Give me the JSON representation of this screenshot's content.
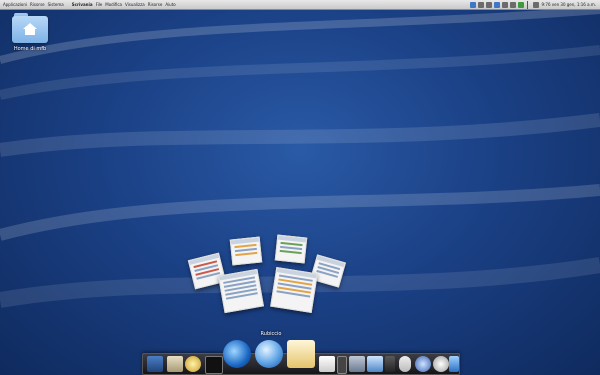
{
  "top_panel": {
    "menus": [
      "Applicazioni",
      "Risorse",
      "Sistema",
      "Scrivania",
      "File",
      "Modifica",
      "Visualizza",
      "Risorse",
      "Aiuto"
    ],
    "active_menu_index": 3,
    "clock": "9:76  ven 30 gen,  1:16 a.m."
  },
  "desktop": {
    "home_label": "Home di mfb"
  },
  "dock": {
    "hover_label": "Rubiccio",
    "items": [
      "terminal",
      "archive",
      "disc",
      "console",
      "browser-swirl",
      "globe",
      "mail",
      "calendar",
      "phone",
      "media",
      "photos",
      "trash",
      "rabbit",
      "music",
      "settings",
      "app",
      "edit"
    ]
  },
  "colors": {
    "wallpaper": "#1b4186",
    "panel": "#d6d6d6"
  }
}
